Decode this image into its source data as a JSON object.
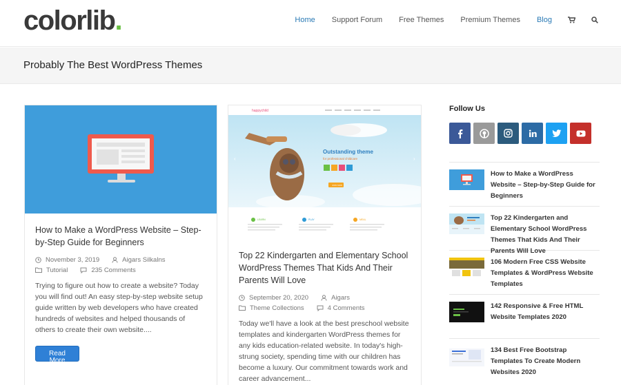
{
  "header": {
    "logo_text": "colorlib",
    "logo_dot": ".",
    "nav": [
      {
        "label": "Home",
        "active": true
      },
      {
        "label": "Support Forum",
        "active": false
      },
      {
        "label": "Free Themes",
        "active": false
      },
      {
        "label": "Premium Themes",
        "active": false
      },
      {
        "label": "Blog",
        "active": true
      }
    ],
    "icons": [
      "cart-icon",
      "search-icon"
    ]
  },
  "page_title": "Probably The Best WordPress Themes",
  "posts": [
    {
      "title": "How to Make a WordPress Website – Step-by-Step Guide for Beginners",
      "date": "November 3, 2019",
      "author": "Aigars Silkalns",
      "category": "Tutorial",
      "comments": "235 Comments",
      "excerpt": "Trying to figure out how to create a website? Today you will find out! An easy step-by-step website setup guide written by web developers who have created hundreds of websites and helped thousands of others to create their own website....",
      "button": "Read More"
    },
    {
      "title": "Top 22 Kindergarten and Elementary School WordPress Themes That Kids And Their Parents Will Love",
      "date": "September 20, 2020",
      "author": "Aigars",
      "category": "Theme Collections",
      "comments": "4 Comments",
      "excerpt": "Today we'll have a look at the best preschool website templates and kindergarten WordPress themes for any kids education-related website. In today's high-strung society, spending time with our children has become a luxury. Our commitment towards work and career advancement...",
      "image_text": {
        "brand": "happychild",
        "headline": "Outstanding theme",
        "subline": "for professional childcare",
        "cta": "JOIN NOW",
        "features": [
          "LEARN",
          "PLAY",
          "MEAL"
        ]
      }
    }
  ],
  "sidebar": {
    "follow_title": "Follow Us",
    "social": [
      {
        "name": "facebook-icon",
        "color": "#3b5998"
      },
      {
        "name": "github-icon",
        "color": "#9a9a9a"
      },
      {
        "name": "instagram-icon",
        "color": "#2c5b7d"
      },
      {
        "name": "linkedin-icon",
        "color": "#2c6ba5"
      },
      {
        "name": "twitter-icon",
        "color": "#1da1f2"
      },
      {
        "name": "youtube-icon",
        "color": "#c4302b"
      }
    ],
    "recent": [
      "How to Make a WordPress Website – Step-by-Step Guide for Beginners",
      "Top 22 Kindergarten and Elementary School WordPress Themes That Kids And Their Parents Will Love",
      "106 Modern Free CSS Website Templates & WordPress Website Templates",
      "142 Responsive & Free HTML Website Templates 2020",
      "134 Best Free Bootstrap Templates To Create Modern Websites 2020"
    ]
  }
}
